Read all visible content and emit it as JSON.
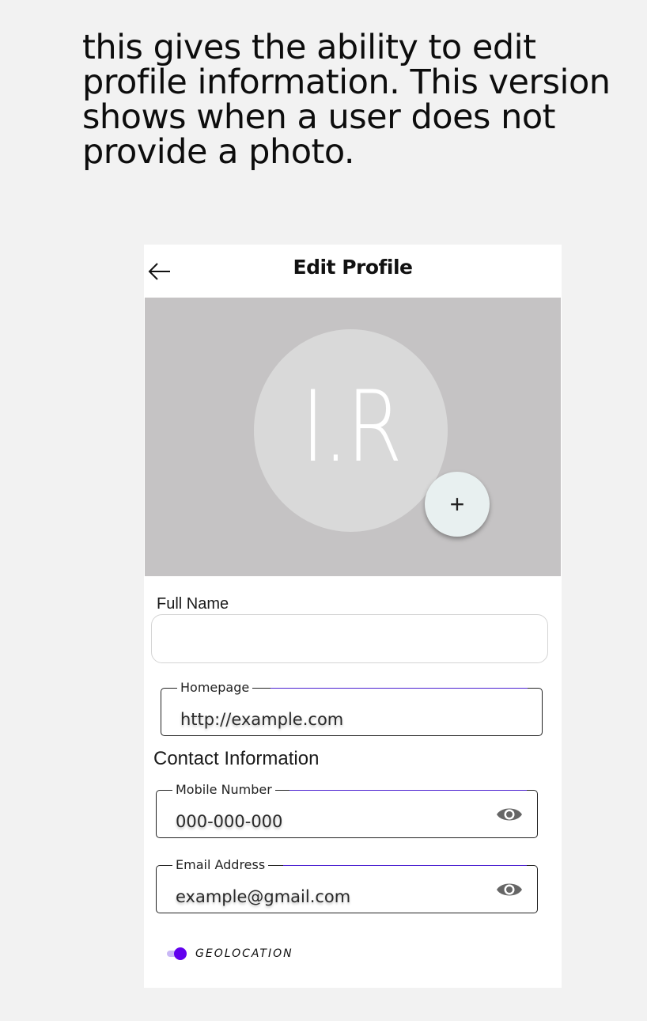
{
  "caption": "this gives the ability to edit profile information. This version shows when a user does not provide a photo.",
  "header": {
    "title": "Edit Profile",
    "back_icon": "arrow-left-icon"
  },
  "profile": {
    "initials": "I.R",
    "add_photo_icon": "+"
  },
  "form": {
    "full_name": {
      "label": "Full Name",
      "value": ""
    },
    "homepage": {
      "label": "Homepage",
      "value": "http://example.com"
    },
    "contact_section_title": "Contact Information",
    "mobile": {
      "label": "Mobile Number",
      "value": "000-000-000",
      "icon": "eye-icon"
    },
    "email": {
      "label": "Email Address",
      "value": "example@gmail.com",
      "icon": "eye-icon"
    },
    "geolocation": {
      "label": "GEOLOCATION",
      "enabled": true
    }
  },
  "colors": {
    "accent": "#6200ee",
    "banner": "#c5c3c4",
    "avatar": "#d9d9d9",
    "background": "#f2f2f2"
  }
}
